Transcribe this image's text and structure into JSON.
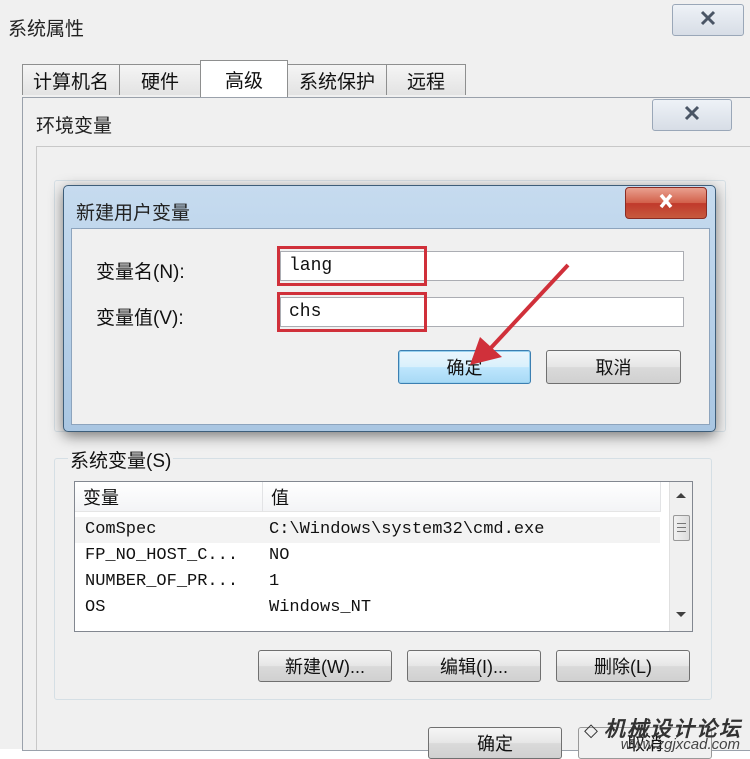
{
  "system_properties": {
    "title": "系统属性",
    "tabs": [
      "计算机名",
      "硬件",
      "高级",
      "系统保护",
      "远程"
    ],
    "active_tab": "高级"
  },
  "environment_variables": {
    "title": "环境变量",
    "user_section_label": "",
    "system_section_label": "系统变量(S)",
    "columns": [
      "变量",
      "值"
    ],
    "rows": [
      {
        "name": "ComSpec",
        "value": "C:\\Windows\\system32\\cmd.exe"
      },
      {
        "name": "FP_NO_HOST_C...",
        "value": "NO"
      },
      {
        "name": "NUMBER_OF_PR...",
        "value": "1"
      },
      {
        "name": "OS",
        "value": "Windows_NT"
      }
    ],
    "buttons": {
      "new": "新建(W)...",
      "edit": "编辑(I)...",
      "delete": "删除(L)"
    },
    "bottom_buttons": {
      "ok": "确定",
      "cancel": "取消"
    }
  },
  "new_user_variable": {
    "title": "新建用户变量",
    "name_label": "变量名(N):",
    "value_label": "变量值(V):",
    "name_value": "lang",
    "value_value": "chs",
    "ok_label": "确定",
    "cancel_label": "取消"
  },
  "colors": {
    "highlight": "#d0303a",
    "arrow": "#d0303a"
  },
  "watermark": {
    "text": "机械设计论坛",
    "url": "www.zgjxcad.com"
  }
}
